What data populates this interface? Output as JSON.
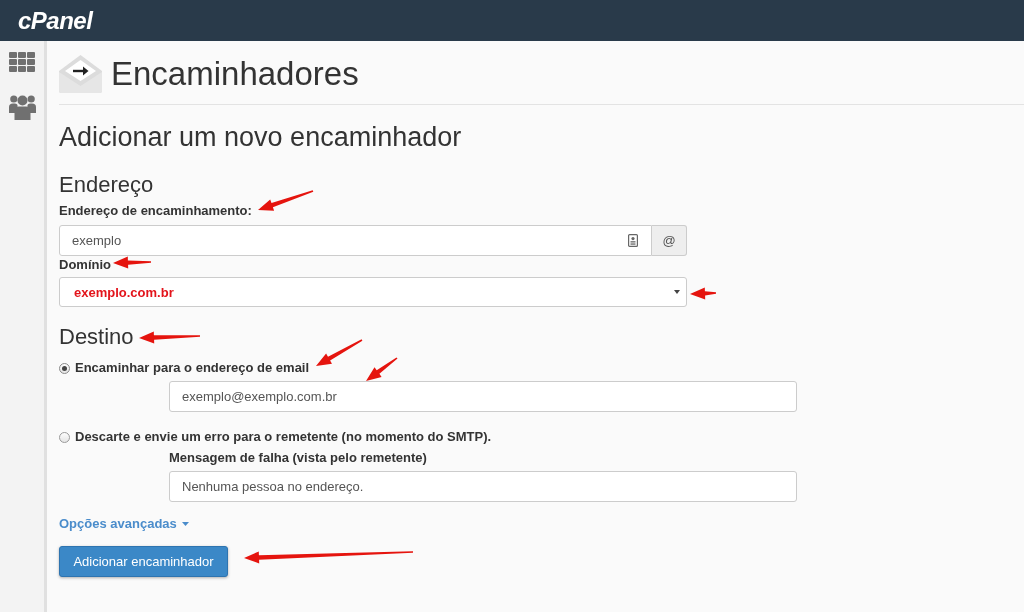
{
  "header": {
    "logo": "cPanel"
  },
  "page": {
    "title": "Encaminhadores",
    "heading": "Adicionar um novo encaminhador"
  },
  "address": {
    "heading": "Endereço",
    "forward_label": "Endereço de encaminhamento:",
    "forward_value": "exemplo",
    "addon": "@",
    "domain_label": "Domínio",
    "domain_value": "exemplo.com.br"
  },
  "destination": {
    "heading": "Destino",
    "options": [
      {
        "label": "Encaminhar para o endereço de email",
        "selected": true,
        "field_value": "exemplo@exemplo.com.br"
      },
      {
        "label": "Descarte e envie um erro para o remetente (no momento do SMTP).",
        "selected": false,
        "field_label": "Mensagem de falha (vista pelo remetente)",
        "field_value": "Nenhuma pessoa no endereço."
      }
    ]
  },
  "advanced_link": "Opções avançadas",
  "submit_button": "Adicionar encaminhador"
}
